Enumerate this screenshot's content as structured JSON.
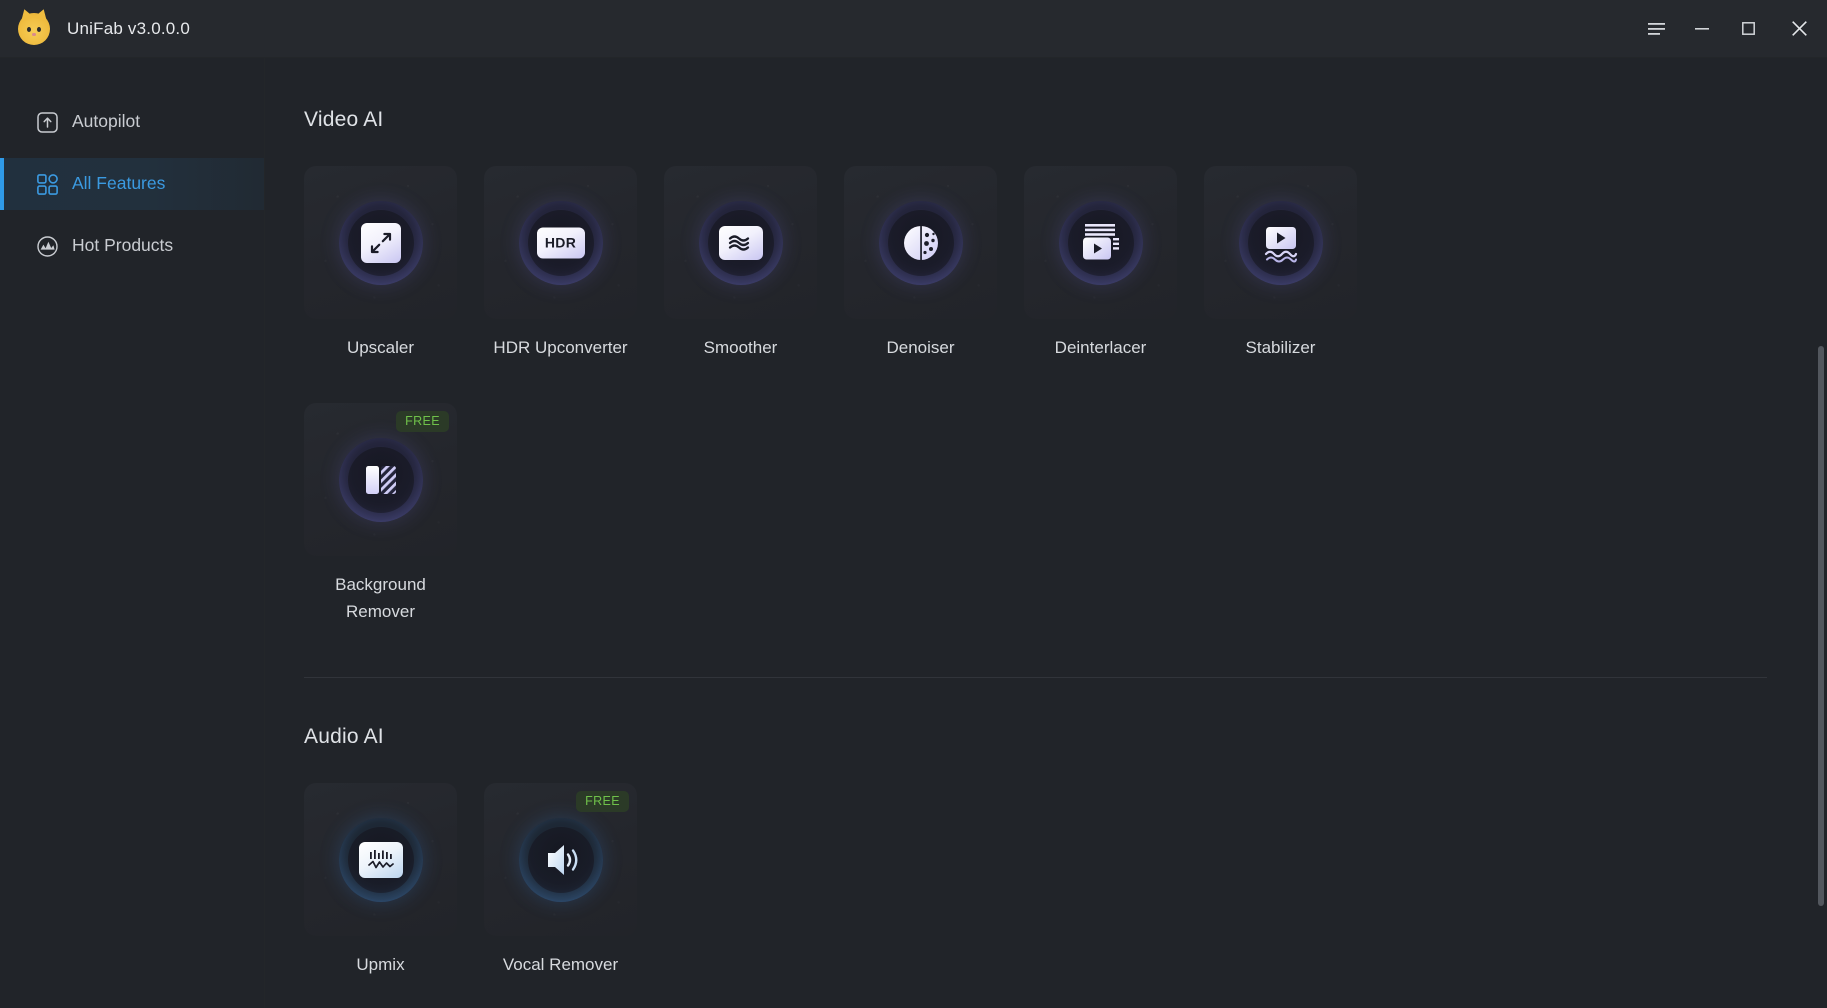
{
  "window": {
    "title": "UniFab v3.0.0.0",
    "logo_icon": "cat-face-icon",
    "controls": [
      {
        "name": "menu-button",
        "icon": "hamburger-menu-icon",
        "label": "Menu"
      },
      {
        "name": "minimize-button",
        "icon": "minimize-icon",
        "label": "Minimize"
      },
      {
        "name": "maximize-button",
        "icon": "maximize-icon",
        "label": "Maximize"
      },
      {
        "name": "close-button",
        "icon": "close-icon",
        "label": "Close"
      }
    ]
  },
  "sidebar": {
    "items": [
      {
        "label": "Autopilot",
        "icon": "upload-box-icon",
        "active": false
      },
      {
        "label": "All Features",
        "icon": "grid-squares-icon",
        "active": true
      },
      {
        "label": "Hot Products",
        "icon": "hot-trending-icon",
        "active": false
      }
    ]
  },
  "sections": [
    {
      "title": "Video AI",
      "cards": [
        {
          "label": "Upscaler",
          "icon": "expand-arrows-icon",
          "badge": "",
          "theme": "purple"
        },
        {
          "label": "HDR Upconverter",
          "icon": "hdr-text-icon",
          "badge": "",
          "theme": "purple"
        },
        {
          "label": "Smoother",
          "icon": "wavy-lines-icon",
          "badge": "",
          "theme": "purple"
        },
        {
          "label": "Denoiser",
          "icon": "noise-circle-icon",
          "badge": "",
          "theme": "purple"
        },
        {
          "label": "Deinterlacer",
          "icon": "scanlines-play-icon",
          "badge": "",
          "theme": "purple"
        },
        {
          "label": "Stabilizer",
          "icon": "stabilize-play-icon",
          "badge": "",
          "theme": "purple"
        },
        {
          "label": "Background Remover",
          "icon": "background-split-icon",
          "badge": "FREE",
          "theme": "purple"
        }
      ]
    },
    {
      "title": "Audio AI",
      "cards": [
        {
          "label": "Upmix",
          "icon": "waveform-icon",
          "badge": "",
          "theme": "blue"
        },
        {
          "label": "Vocal Remover",
          "icon": "speaker-waves-icon",
          "badge": "FREE",
          "theme": "blue"
        }
      ]
    }
  ],
  "colors": {
    "accent": "#2f9ae8",
    "badge_text": "#6fc04a",
    "badge_bg": "#2b3a27",
    "window_bg": "#212429",
    "titlebar_bg": "#26292e",
    "card_bg": "#25282d"
  },
  "hdr_glyph_text": "HDR"
}
